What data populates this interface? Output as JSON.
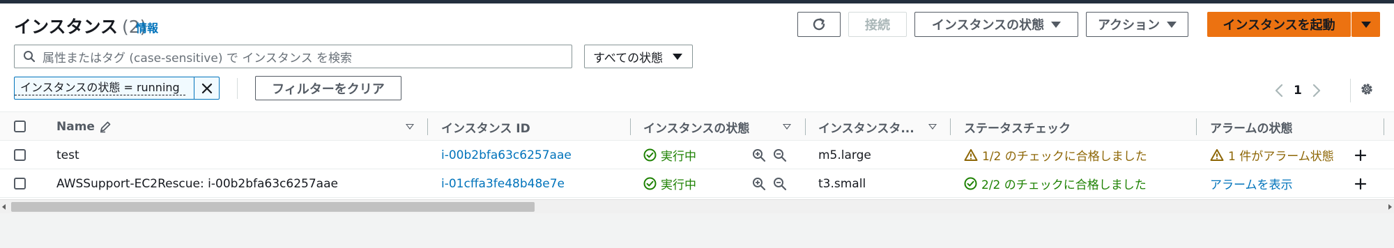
{
  "header": {
    "title": "インスタンス",
    "count": "(2)",
    "info": "情報"
  },
  "toolbar": {
    "refresh_icon": "refresh-icon",
    "connect": "接続",
    "instance_state": "インスタンスの状態",
    "actions": "アクション",
    "launch": "インスタンスを起動",
    "primary_color": "#ec7211"
  },
  "search": {
    "placeholder": "属性またはタグ (case-sensitive) で インスタンス を検索",
    "state_filter": "すべての状態"
  },
  "filter": {
    "token": "インスタンスの状態 = running",
    "clear": "フィルターをクリア"
  },
  "pagination": {
    "page": "1"
  },
  "table": {
    "columns": [
      "Name",
      "インスタンス ID",
      "インスタンスの状態",
      "インスタンスタ...",
      "ステータスチェック",
      "アラームの状態"
    ],
    "rows": [
      {
        "name": "test",
        "id": "i-00b2bfa63c6257aae",
        "state": "実行中",
        "type": "m5.large",
        "status": "1/2 のチェックに合格しました",
        "status_kind": "warning",
        "alarm": "1 件がアラーム状態",
        "alarm_kind": "warning"
      },
      {
        "name": "AWSSupport-EC2Rescue: i-00b2bfa63c6257aae",
        "id": "i-01cffa3fe48b48e7e",
        "state": "実行中",
        "type": "t3.small",
        "status": "2/2 のチェックに合格しました",
        "status_kind": "success",
        "alarm": "アラームを表示",
        "alarm_kind": "link"
      }
    ]
  },
  "colors": {
    "link": "#0073bb",
    "success": "#1d8102",
    "warning": "#8d6605"
  }
}
